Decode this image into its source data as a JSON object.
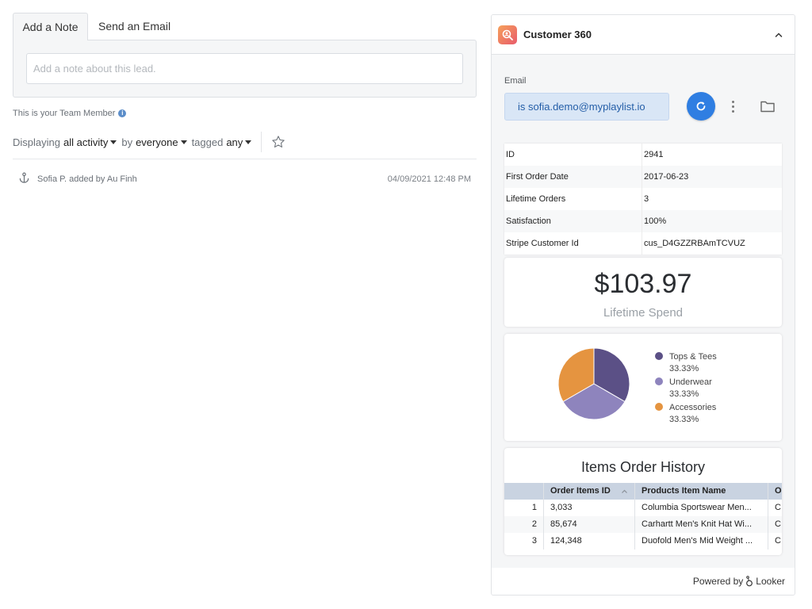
{
  "tabs": {
    "note": "Add a Note",
    "email": "Send an Email"
  },
  "note": {
    "placeholder": "Add a note about this lead."
  },
  "team_note": "This is your Team Member",
  "filters": {
    "displaying": "Displaying",
    "activity": "all activity",
    "by": "by",
    "who": "everyone",
    "tagged": "tagged",
    "tag": "any"
  },
  "activity": [
    {
      "text": "Sofia P. added by Au Finh",
      "timestamp": "04/09/2021 12:48 PM"
    }
  ],
  "c360": {
    "title": "Customer 360",
    "email_label": "Email",
    "email_value": "is sofia.demo@myplaylist.io",
    "info_rows": [
      {
        "key": "ID",
        "value": "2941"
      },
      {
        "key": "First Order Date",
        "value": "2017-06-23"
      },
      {
        "key": "Lifetime Orders",
        "value": "3"
      },
      {
        "key": "Satisfaction",
        "value": "100%"
      },
      {
        "key": "Stripe Customer Id",
        "value": "cus_D4GZZRBAmTCVUZ"
      }
    ],
    "spend_value": "$103.97",
    "spend_label": "Lifetime Spend",
    "orders": {
      "title": "Items Order History",
      "columns": [
        "Order Items ID",
        "Products Item Name",
        "O"
      ],
      "rows": [
        {
          "idx": "1",
          "id": "3,033",
          "name": "Columbia Sportswear Men...",
          "extra": "C"
        },
        {
          "idx": "2",
          "id": "85,674",
          "name": "Carhartt Men's Knit Hat Wi...",
          "extra": "C"
        },
        {
          "idx": "3",
          "id": "124,348",
          "name": "Duofold Men's Mid Weight ...",
          "extra": "C"
        }
      ]
    },
    "powered_by": "Powered by",
    "looker": "Looker"
  },
  "chart_data": {
    "type": "pie",
    "categories": [
      "Tops & Tees",
      "Underwear",
      "Accessories"
    ],
    "values": [
      33.33,
      33.33,
      33.33
    ],
    "labels": [
      "33.33%",
      "33.33%",
      "33.33%"
    ],
    "colors": [
      "#5b5086",
      "#8e84bd",
      "#e59440"
    ],
    "legend": "right"
  },
  "colors": {
    "accent": "#2f7ee2",
    "email_pill_bg": "#d9e6f6",
    "table_header_bg": "#c9d3e1"
  }
}
